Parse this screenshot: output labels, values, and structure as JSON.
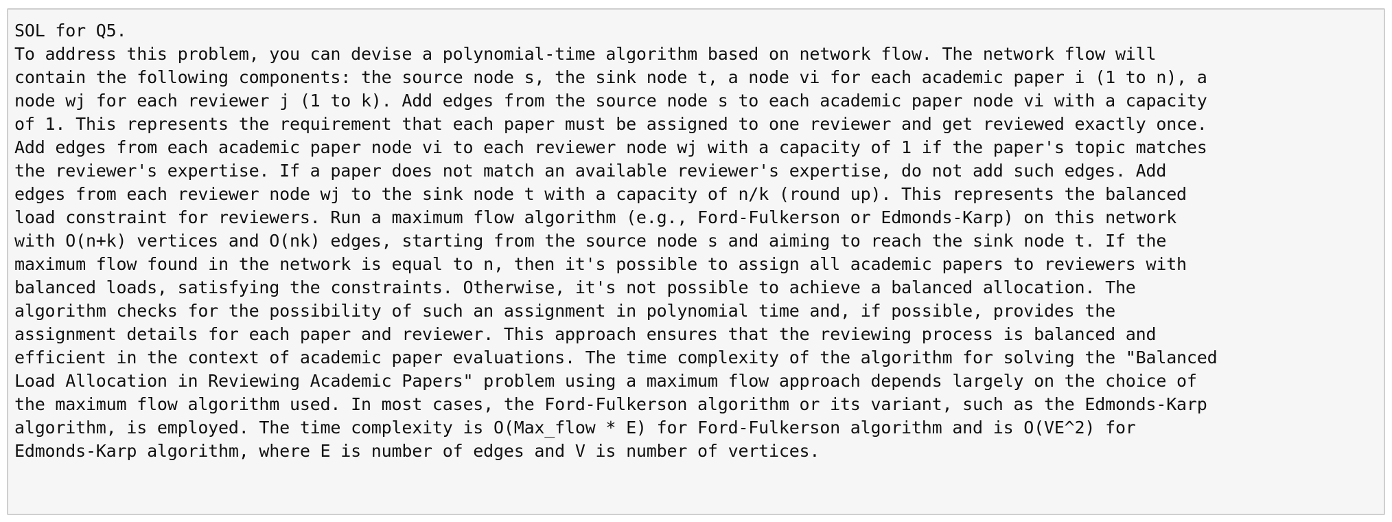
{
  "answer": {
    "lines": [
      "SOL for Q5.",
      "To address this problem, you can devise a polynomial-time algorithm based on network flow. The network flow will",
      "contain the following components: the source node s, the sink node t, a node vi for each academic paper i (1 to n), a",
      "node wj for each reviewer j (1 to k). Add edges from the source node s to each academic paper node vi with a capacity",
      "of 1. This represents the requirement that each paper must be assigned to one reviewer and get reviewed exactly once.",
      "Add edges from each academic paper node vi to each reviewer node wj with a capacity of 1 if the paper's topic matches",
      "the reviewer's expertise. If a paper does not match an available reviewer's expertise, do not add such edges. Add",
      "edges from each reviewer node wj to the sink node t with a capacity of n/k (round up). This represents the balanced",
      "load constraint for reviewers. Run a maximum flow algorithm (e.g., Ford-Fulkerson or Edmonds-Karp) on this network",
      "with O(n+k) vertices and O(nk) edges, starting from the source node s and aiming to reach the sink node t. If the",
      "maximum flow found in the network is equal to n, then it's possible to assign all academic papers to reviewers with",
      "balanced loads, satisfying the constraints. Otherwise, it's not possible to achieve a balanced allocation. The",
      "algorithm checks for the possibility of such an assignment in polynomial time and, if possible, provides the",
      "assignment details for each paper and reviewer. This approach ensures that the reviewing process is balanced and",
      "efficient in the context of academic paper evaluations. The time complexity of the algorithm for solving the \"Balanced",
      "Load Allocation in Reviewing Academic Papers\" problem using a maximum flow approach depends largely on the choice of",
      "the maximum flow algorithm used. In most cases, the Ford-Fulkerson algorithm or its variant, such as the Edmonds-Karp",
      "algorithm, is employed. The time complexity is O(Max_flow * E) for Ford-Fulkerson algorithm and is O(VE^2) for",
      "Edmonds-Karp algorithm, where E is number of edges and V is number of vertices."
    ]
  }
}
